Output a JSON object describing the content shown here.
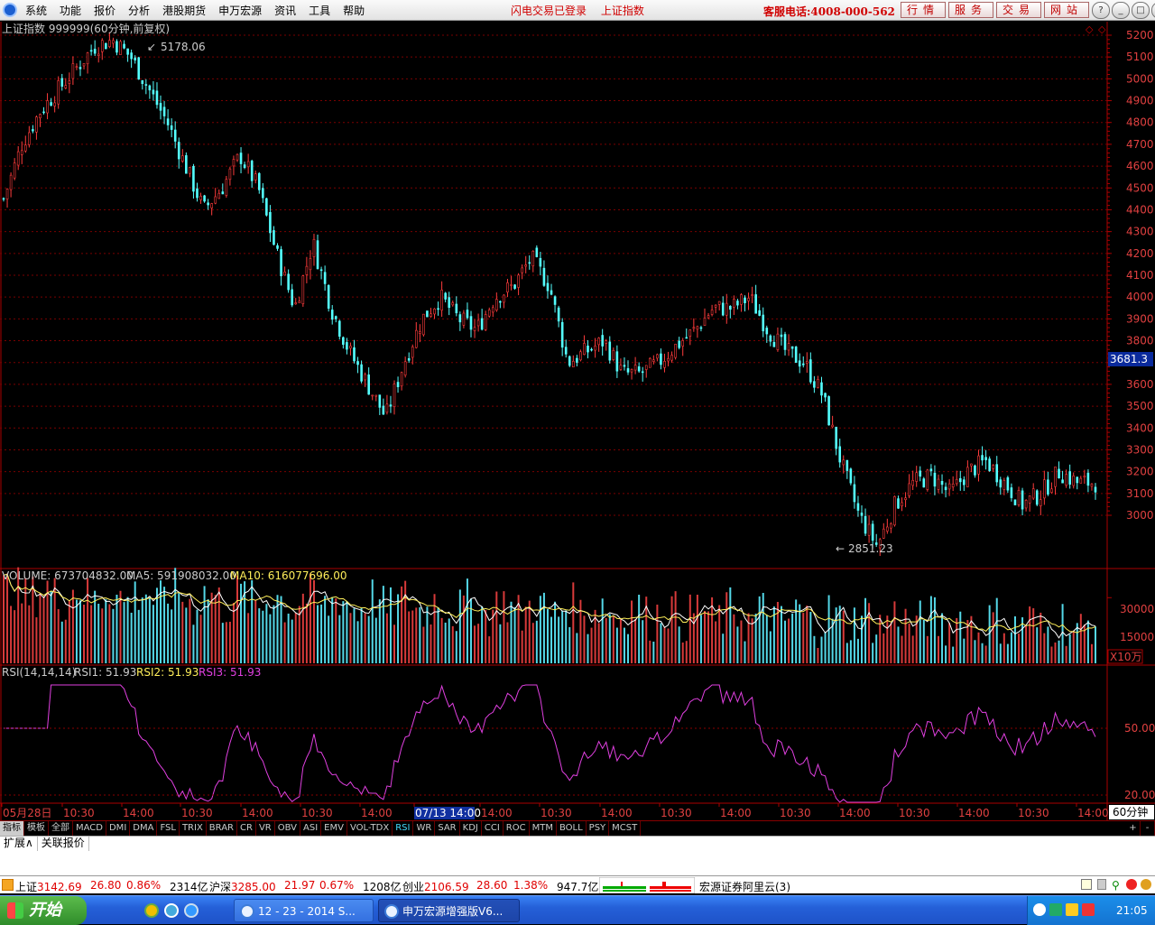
{
  "menubar": {
    "menus": [
      "系统",
      "功能",
      "报价",
      "分析",
      "港股期货",
      "申万宏源",
      "资讯",
      "工具",
      "帮助"
    ],
    "status_flash": "闪电交易已登录",
    "status_index": "上证指数",
    "hotline": "客服电话:4008-000-562",
    "buttons": [
      "行情",
      "服务",
      "交易",
      "网站"
    ],
    "window_controls": [
      "?",
      "_",
      "□",
      "×"
    ]
  },
  "chart": {
    "title": "上证指数 999999(60分钟,前复权)",
    "high_label": "5178.06",
    "low_label": "2851.23",
    "current_price": "3681.3",
    "price_ticks": [
      "5200",
      "5100",
      "5000",
      "4900",
      "4800",
      "4700",
      "4600",
      "4500",
      "4400",
      "4300",
      "4200",
      "4100",
      "4000",
      "3900",
      "3800",
      "3700",
      "3600",
      "3500",
      "3400",
      "3300",
      "3200",
      "3100",
      "3000"
    ],
    "volume_header": {
      "label": "VOLUME: 673704832.00",
      "ma5": "MA5: 591908032.00",
      "ma10": "MA10: 616077696.00"
    },
    "volume_ticks": [
      "30000",
      "15000"
    ],
    "volume_unit": "X10万",
    "rsi_header": {
      "label": "RSI(14,14,14)",
      "rsi1": "RSI1: 51.93",
      "rsi2": "RSI2: 51.93",
      "rsi3": "RSI3: 51.93"
    },
    "rsi_ticks": [
      "50.00",
      "20.00"
    ],
    "time_axis": [
      "05月28日",
      "10:30",
      "14:00",
      "10:30",
      "14:00",
      "10:30",
      "14:00",
      "07/13 14:00",
      "14:00",
      "10:30",
      "14:00",
      "10:30",
      "14:00",
      "10:30",
      "14:00",
      "10:30",
      "14:00",
      "10:30",
      "14:00",
      "10:30",
      "14:00"
    ],
    "period": "60分钟"
  },
  "chart_data": {
    "type": "candlestick",
    "title": "上证指数 999999(60分钟,前复权)",
    "ylim": [
      2800,
      5250
    ],
    "high": 5178.06,
    "low": 2851.23,
    "last": 3681.3,
    "trend_path": [
      4450,
      4700,
      4850,
      4950,
      5050,
      5150,
      5178,
      5100,
      4950,
      4800,
      4600,
      4400,
      4500,
      4650,
      4500,
      4200,
      3950,
      4250,
      3950,
      3750,
      3600,
      3450,
      3700,
      3900,
      4000,
      3900,
      3850,
      4000,
      4050,
      4180,
      4050,
      3700,
      3750,
      3800,
      3650,
      3650,
      3700,
      3780,
      3850,
      3950,
      3950,
      4000,
      3850,
      3750,
      3700,
      3550,
      3250,
      3000,
      2860,
      3050,
      3150,
      3180,
      3100,
      3200,
      3250,
      3150,
      3050,
      3100,
      3200,
      3150,
      3150
    ]
  },
  "tabbar": {
    "tabs": [
      "指标",
      "模板",
      "全部",
      "MACD",
      "DMI",
      "DMA",
      "FSL",
      "TRIX",
      "BRAR",
      "CR",
      "VR",
      "OBV",
      "ASI",
      "EMV",
      "VOL-TDX",
      "RSI",
      "WR",
      "SAR",
      "KDJ",
      "CCI",
      "ROC",
      "MTM",
      "BOLL",
      "PSY",
      "MCST"
    ],
    "plus": "+",
    "minus": "-"
  },
  "subbar": {
    "items": [
      "扩展∧",
      "关联报价"
    ]
  },
  "statusbar": {
    "sh_name": "上证",
    "sh_value": "3142.69",
    "sh_change": "26.80",
    "sh_pct": "0.86%",
    "sh_amount": "2314亿",
    "hs_name": "沪深",
    "hs_value": "3285.00",
    "hs_change": "21.97",
    "hs_pct": "0.67%",
    "hs_amount": "1208亿",
    "cy_name": "创业",
    "cy_value": "2106.59",
    "cy_change": "28.60",
    "cy_pct": "1.38%",
    "cy_amount": "947.7亿",
    "server": "宏源证券阿里云(3)"
  },
  "taskbar": {
    "start": "开始",
    "windows": [
      "12 - 23 - 2014 S...",
      "申万宏源增强版V6..."
    ],
    "time": "21:05"
  }
}
